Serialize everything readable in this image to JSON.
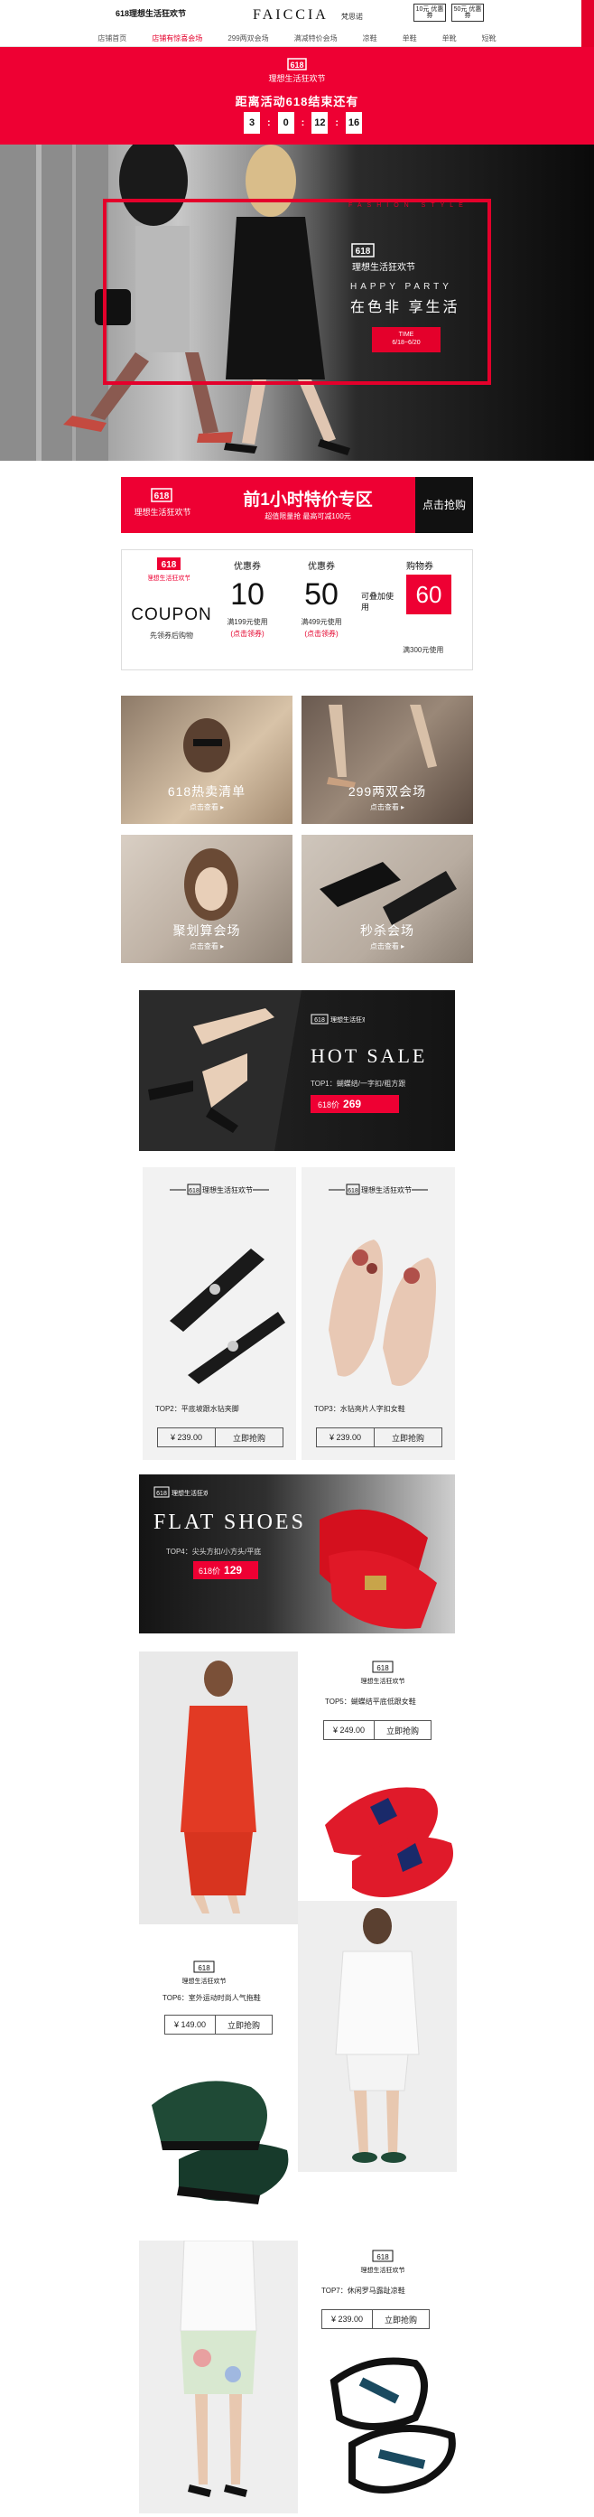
{
  "header": {
    "tag": "618理想生活狂欢节",
    "brand": "FAICCIA",
    "brand_sub": "梵思诺",
    "coupons": [
      "10元 优惠券",
      "50元 优惠券"
    ],
    "nav": [
      "店铺首页",
      "店铺有惊喜会场",
      "299两双会场",
      "满减特价会场",
      "凉鞋",
      "单鞋",
      "单靴",
      "短靴"
    ],
    "nav_active_index": 1
  },
  "countdown": {
    "logo": "618 理想生活狂欢节",
    "title": "距离活动618结束还有",
    "digits": [
      "3",
      "0",
      "12",
      "16"
    ]
  },
  "hero": {
    "style_text": "FASHION STYLE",
    "logo": "618 理想生活狂欢节",
    "happy": "HAPPY PARTY",
    "slogan": "在色非 享生活",
    "time_label": "TIME",
    "time_value": "6/18~6/20"
  },
  "hour_special": {
    "logo": "618 理想生活狂欢节",
    "title": "前1小时特价专区",
    "subtitle": "超值限量抢 最高可减100元",
    "button": "点击抢购"
  },
  "coupon_area": {
    "logo": "618 理想生活狂欢节",
    "word": "COUPON",
    "hint": "先领券后购物",
    "coupons": [
      {
        "label": "优惠券",
        "value": "10",
        "condition": "满199元使用",
        "link": "(点击领券)"
      },
      {
        "label": "优惠券",
        "value": "50",
        "condition": "满499元使用",
        "link": "(点击领券)"
      }
    ],
    "note": "可叠加使用",
    "buy_label": "购物券",
    "buy_value": "60",
    "buy_condition": "满300元使用"
  },
  "venues": [
    {
      "title": "618热卖清单",
      "link": "点击查看 ▸"
    },
    {
      "title": "299两双会场",
      "link": "点击查看 ▸"
    },
    {
      "title": "聚划算会场",
      "link": "点击查看 ▸"
    },
    {
      "title": "秒杀会场",
      "link": "点击查看 ▸"
    }
  ],
  "hot_sale": {
    "logo": "618 理想生活狂欢节",
    "title": "HOT SALE",
    "top1": "TOP1：蝴蝶结/一字扣/粗方跟",
    "price_label": "618价",
    "price": "269"
  },
  "cards": [
    {
      "logo": "618 理想生活狂欢节",
      "desc": "TOP2：平底坡跟水钻夹脚",
      "price": "¥ 239.00",
      "buy": "立即抢购"
    },
    {
      "logo": "618 理想生活狂欢节",
      "desc": "TOP3：水钻亮片人字扣女鞋",
      "price": "¥ 239.00",
      "buy": "立即抢购"
    }
  ],
  "flat_shoes": {
    "logo": "618 理想生活狂欢节",
    "title": "FLAT SHOES",
    "top4": "TOP4：尖头方扣/小方头/平底",
    "price_label": "618价",
    "price": "129"
  },
  "rows": [
    {
      "logo": "618 理想生活狂欢节",
      "desc": "TOP5：蝴蝶结平底低跟女鞋",
      "price": "¥ 249.00",
      "buy": "立即抢购"
    },
    {
      "logo": "618 理想生活狂欢节",
      "desc": "TOP6：室外运动时尚人气拖鞋",
      "price": "¥ 149.00",
      "buy": "立即抢购"
    },
    {
      "logo": "618 理想生活狂欢节",
      "desc": "TOP7：休闲罗马露趾凉鞋",
      "price": "¥ 239.00",
      "buy": "立即抢购"
    }
  ],
  "colors": {
    "accent": "#ee0033",
    "dark": "#111111"
  }
}
